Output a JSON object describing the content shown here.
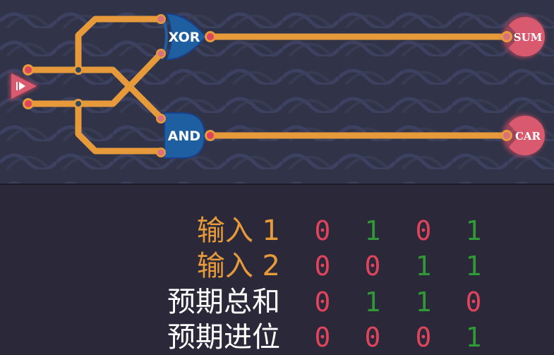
{
  "circuit": {
    "gates": [
      {
        "label": "XOR"
      },
      {
        "label": "AND"
      }
    ],
    "outputs": [
      {
        "label": "SUM"
      },
      {
        "label": "CAR"
      }
    ],
    "input_icon": "play-triangle-icon"
  },
  "table": {
    "rows": [
      {
        "label": "输入 1",
        "color": "#e69a3a",
        "values": [
          "0",
          "1",
          "0",
          "1"
        ]
      },
      {
        "label": "输入 2",
        "color": "#e69a3a",
        "values": [
          "0",
          "0",
          "1",
          "1"
        ]
      },
      {
        "label": "预期总和",
        "color": "#ffffff",
        "values": [
          "0",
          "1",
          "1",
          "0"
        ]
      },
      {
        "label": "预期进位",
        "color": "#ffffff",
        "values": [
          "0",
          "0",
          "0",
          "1"
        ]
      }
    ]
  },
  "colors": {
    "wire": "#e69a3a",
    "zero": "#e0445c",
    "one": "#2f9a35",
    "gate": "#1d5fa0",
    "output": "#d95a6e",
    "background": "#323449"
  }
}
